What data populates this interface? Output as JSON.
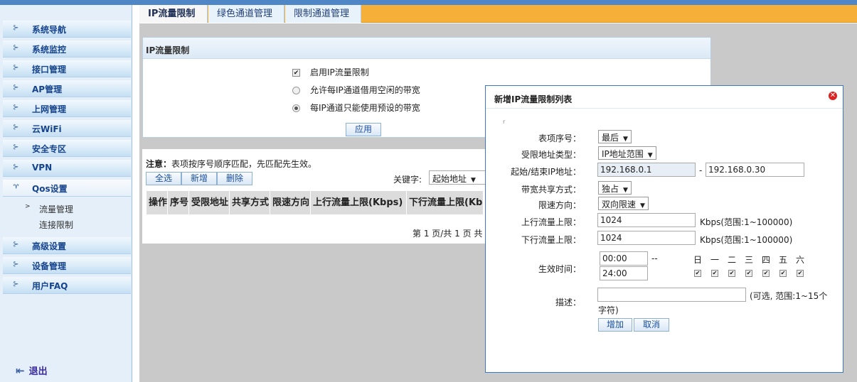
{
  "sidebar": {
    "items": [
      {
        "label": "系统导航"
      },
      {
        "label": "系统监控"
      },
      {
        "label": "接口管理"
      },
      {
        "label": "AP管理"
      },
      {
        "label": "上网管理"
      },
      {
        "label": "云WiFi"
      },
      {
        "label": "安全专区"
      },
      {
        "label": "VPN"
      },
      {
        "label": "Qos设置"
      }
    ],
    "sub_items": [
      {
        "label": "流量管理"
      },
      {
        "label": "连接限制"
      }
    ],
    "items_after": [
      {
        "label": "高级设置"
      },
      {
        "label": "设备管理"
      },
      {
        "label": "用户FAQ"
      }
    ],
    "logout": "退出"
  },
  "tabs": [
    {
      "label": "IP流量限制"
    },
    {
      "label": "绿色通道管理"
    },
    {
      "label": "限制通道管理"
    }
  ],
  "panel": {
    "title": "IP流量限制",
    "option_enable": "启用IP流量限制",
    "option_borrow": "允许每IP通道借用空闲的带宽",
    "option_preset": "每IP通道只能使用预设的带宽",
    "apply": "应用"
  },
  "list": {
    "note_bold": "注意：",
    "note_text": "表项按序号顺序匹配，先匹配先生效。",
    "btn_select_all": "全选",
    "btn_add": "新增",
    "btn_delete": "删除",
    "keyword_label": "关键字:",
    "keyword_value": "起始地址",
    "headers": [
      "操作",
      "序号",
      "受限地址",
      "共享方式",
      "限速方向",
      "上行流量上限(Kbps)",
      "下行流量上限(Kb"
    ],
    "page_info": "第 1 页/共 1 页 共"
  },
  "dialog": {
    "title": "新增IP流量限制列表",
    "tick": "r",
    "labels": {
      "index": "表项序号：",
      "addr_type": "受限地址类型：",
      "ip_range": "起始/结束IP地址：",
      "share": "带宽共享方式：",
      "direction": "限速方向：",
      "up": "上行流量上限：",
      "down": "下行流量上限：",
      "time": "生效时间：",
      "desc": "描述："
    },
    "index_value": "最后",
    "addr_type_value": "IP地址范围",
    "ip_start": "192.168.0.1",
    "ip_sep": "-",
    "ip_end": "192.168.0.30",
    "share_value": "独占",
    "direction_value": "双向限速",
    "up_value": "1024",
    "up_hint": "Kbps(范围:1~100000)",
    "down_value": "1024",
    "down_hint": "Kbps(范围:1~100000)",
    "time_start": "00:00",
    "time_sep": "--",
    "time_end": "24:00",
    "days": [
      "日",
      "一",
      "二",
      "三",
      "四",
      "五",
      "六"
    ],
    "desc_hint_1": "(可选, 范围:1~15个",
    "desc_hint_2": "字符)",
    "btn_add": "增加",
    "btn_cancel": "取消"
  }
}
